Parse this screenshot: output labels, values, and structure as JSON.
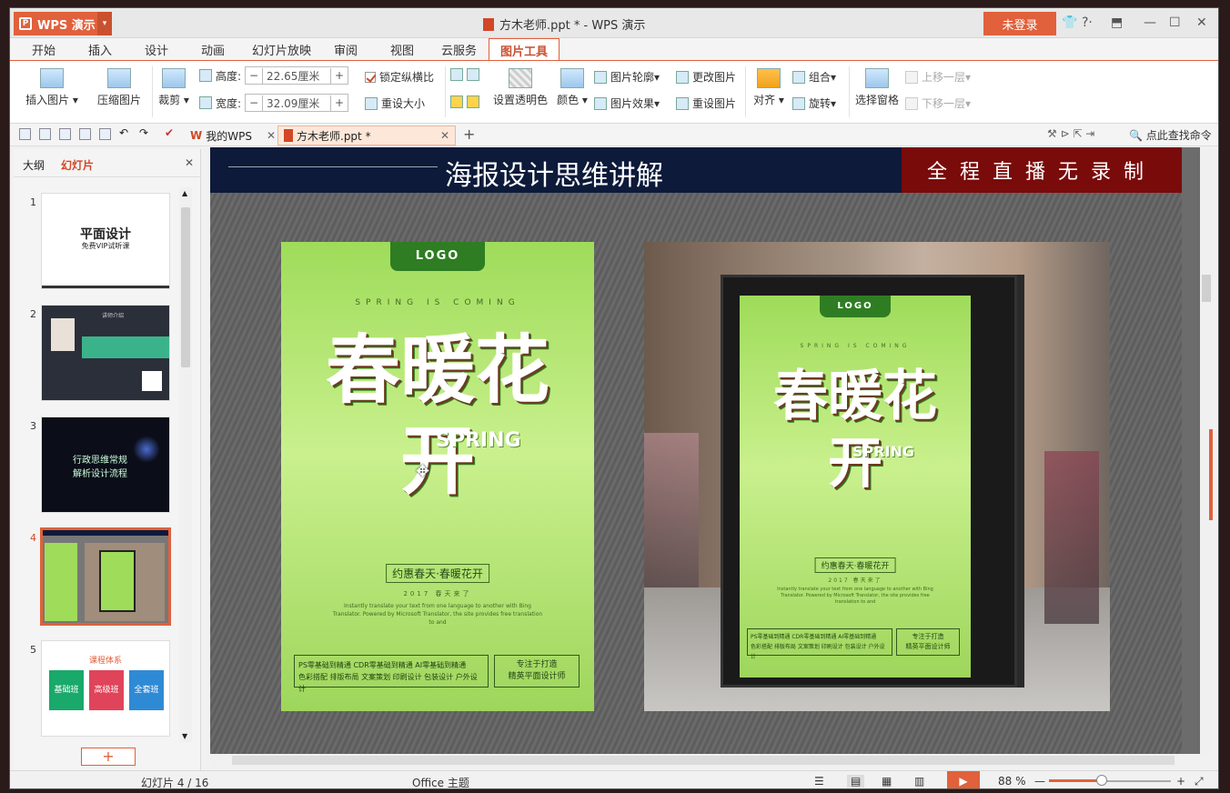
{
  "app": {
    "name": "WPS 演示",
    "doc_title": "方木老师.ppt * - WPS 演示",
    "login": "未登录"
  },
  "menu": [
    "开始",
    "插入",
    "设计",
    "动画",
    "幻灯片放映",
    "审阅",
    "视图",
    "云服务",
    "图片工具"
  ],
  "ribbon": {
    "insert_picture": "插入图片",
    "compress_picture": "压缩图片",
    "crop": "裁剪",
    "height_label": "高度:",
    "height_value": "22.65厘米",
    "width_label": "宽度:",
    "width_value": "32.09厘米",
    "lock_ratio": "锁定纵横比",
    "reset_size": "重设大小",
    "set_transparent": "设置透明色",
    "color": "颜色",
    "picture_outline": "图片轮廓",
    "picture_effect": "图片效果",
    "change_picture": "更改图片",
    "reset_picture": "重设图片",
    "align": "对齐",
    "group": "组合",
    "rotate": "旋转",
    "select_pane": "选择窗格",
    "bring_forward": "上移一层",
    "send_backward": "下移一层"
  },
  "quickbar": {
    "tab1": "我的WPS",
    "tab2": "方木老师.ppt *",
    "search": "点此查找命令"
  },
  "leftpanel": {
    "tab_outline": "大纲",
    "tab_slides": "幻灯片",
    "slides": [
      {
        "num": "1",
        "title": "平面设计",
        "subtitle": "免费VIP试听课"
      },
      {
        "num": "2",
        "title": "讲师介绍"
      },
      {
        "num": "3",
        "title": "行政思维常规\n解析设计流程"
      },
      {
        "num": "4"
      },
      {
        "num": "5",
        "title": "课程体系",
        "b1": "基础班",
        "b2": "高级班",
        "b3": "全套班"
      }
    ]
  },
  "slide": {
    "heading": "海报设计思维讲解",
    "banner": "全程直播无录制",
    "poster": {
      "logo": "LOGO",
      "tagline": "SPRING IS COMING",
      "big": "春暖花开",
      "spring": "SPRING",
      "slogan": "约惠春天·春暖花开",
      "year": "2017  春天来了",
      "desc": "Instantly translate your text from one language to another with Bing Translator. Powered by Microsoft Translator, the site provides free translation to and",
      "line1": "PS零基础到精通  CDR零基础到精通  AI零基础到精通",
      "line2": "色彩搭配  排版布局  文案策划  印刷设计  包装设计  户外设计",
      "focus1": "专注于打造",
      "focus2": "精英平面设计师"
    }
  },
  "status": {
    "slide_count": "幻灯片 4 / 16",
    "theme": "Office 主题",
    "zoom": "88 %"
  },
  "colors": {
    "accent": "#e0613c",
    "slide_header": "#0d1a3a",
    "banner_red": "#7a0b0b",
    "poster_green": "#9fdc5a"
  }
}
